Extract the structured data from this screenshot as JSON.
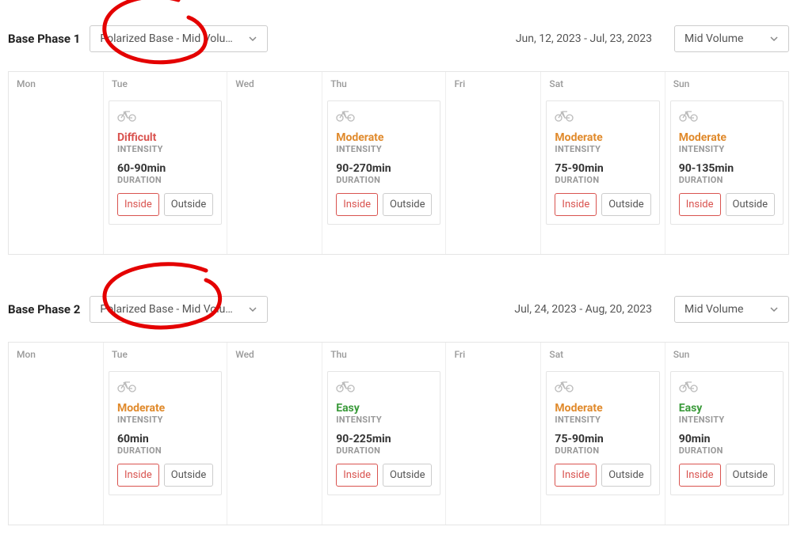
{
  "labels": {
    "intensity": "INTENSITY",
    "duration": "DURATION",
    "inside": "Inside",
    "outside": "Outside"
  },
  "days": [
    "Mon",
    "Tue",
    "Wed",
    "Thu",
    "Fri",
    "Sat",
    "Sun"
  ],
  "phases": [
    {
      "title": "Base Phase 1",
      "plan": "Polarized Base - Mid Volu…",
      "date_range": "Jun, 12, 2023 - Jul, 23, 2023",
      "volume": "Mid Volume",
      "workouts": {
        "Tue": {
          "intensity": "Difficult",
          "duration": "60-90min"
        },
        "Thu": {
          "intensity": "Moderate",
          "duration": "90-270min"
        },
        "Sat": {
          "intensity": "Moderate",
          "duration": "75-90min"
        },
        "Sun": {
          "intensity": "Moderate",
          "duration": "90-135min"
        }
      }
    },
    {
      "title": "Base Phase 2",
      "plan": "Polarized Base - Mid Volu…",
      "date_range": "Jul, 24, 2023 - Aug, 20, 2023",
      "volume": "Mid Volume",
      "workouts": {
        "Tue": {
          "intensity": "Moderate",
          "duration": "60min"
        },
        "Thu": {
          "intensity": "Easy",
          "duration": "90-225min"
        },
        "Sat": {
          "intensity": "Moderate",
          "duration": "75-90min"
        },
        "Sun": {
          "intensity": "Easy",
          "duration": "90min"
        }
      }
    }
  ]
}
